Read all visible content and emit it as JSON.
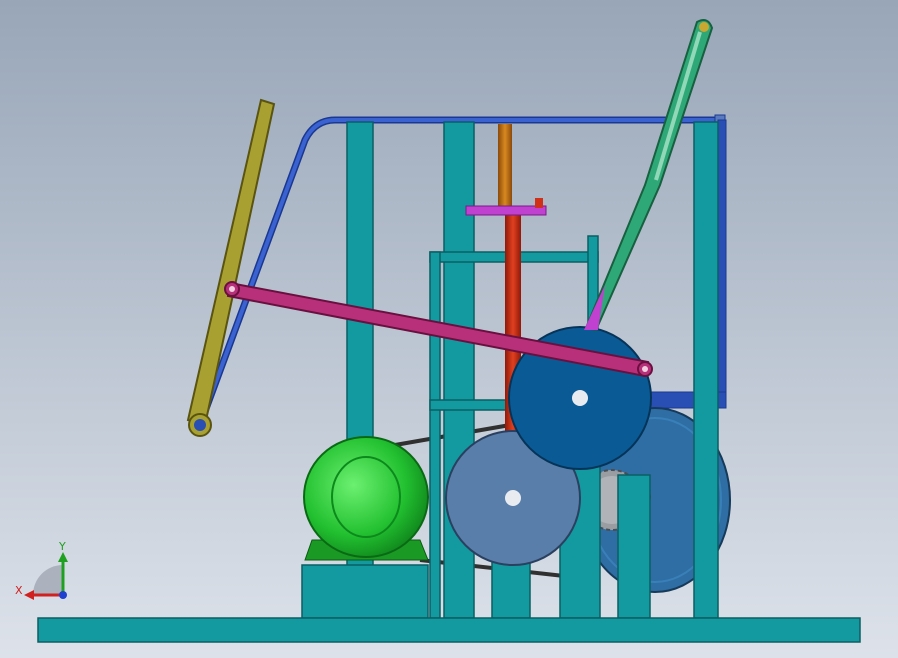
{
  "viewport": {
    "background_top": "#98a6b8",
    "background_bottom": "#dde2ea"
  },
  "colors": {
    "frame": "#139aa0",
    "frame_edge": "#0b5e62",
    "blue_rod": "#2a4fb4",
    "olive_link": "#a8a030",
    "green_link": "#2fa878",
    "crank_rod": "#b8307a",
    "magenta_part": "#c040d0",
    "orange_shaft": "#c06810",
    "red_shaft": "#d03018",
    "motor": "#22c030",
    "big_pulley": "#2e6ea4",
    "cam_wheel": "#0a5a96",
    "light_wheel": "#5a7eaa",
    "gear": "#9a9ea2"
  },
  "triad": {
    "x_label": "X",
    "y_label": "Y",
    "x_color": "#d02020",
    "y_color": "#20a020",
    "origin_color": "#2040d0"
  }
}
